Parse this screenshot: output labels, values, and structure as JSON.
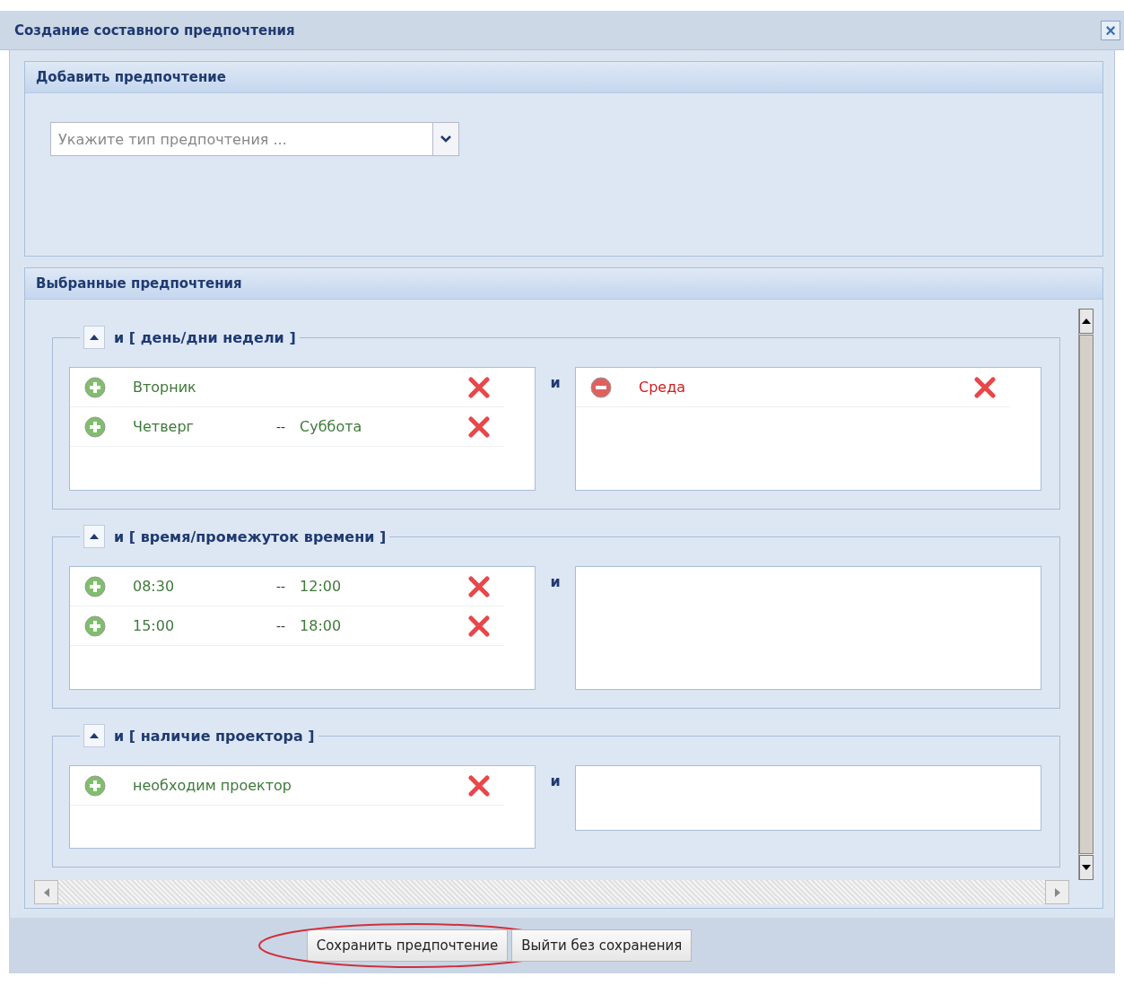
{
  "window": {
    "title": "Создание составного предпочтения",
    "close": "×"
  },
  "add_section": {
    "title": "Добавить предпочтение",
    "type_select": {
      "placeholder": "Укажите тип предпочтения ..."
    }
  },
  "selected_section": {
    "title": "Выбранные предпочтения",
    "groups": [
      {
        "title": "и [ день/дни недели ]",
        "connector": "и",
        "expanded": true,
        "left": [
          {
            "kind": "include",
            "from": "Вторник"
          },
          {
            "kind": "include",
            "from": "Четверг",
            "dash": "--",
            "to": "Суббота"
          }
        ],
        "right": [
          {
            "kind": "exclude",
            "from": "Среда"
          }
        ]
      },
      {
        "title": "и [ время/промежуток времени ]",
        "connector": "и",
        "expanded": true,
        "left": [
          {
            "kind": "include",
            "from": "08:30",
            "dash": "--",
            "to": "12:00"
          },
          {
            "kind": "include",
            "from": "15:00",
            "dash": "--",
            "to": "18:00"
          }
        ]
      },
      {
        "title": "и [ наличие проектора ]",
        "connector": "и",
        "expanded": true,
        "left": [
          {
            "kind": "include",
            "from": "необходим проектор"
          }
        ]
      }
    ]
  },
  "buttons": [
    {
      "label": "Сохранить предпочтение",
      "highlighted": true
    },
    {
      "label": "Выйти без сохранения",
      "highlighted": false
    }
  ]
}
